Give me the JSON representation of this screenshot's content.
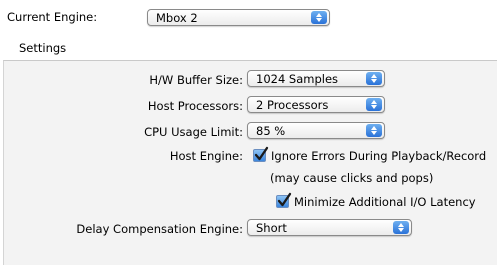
{
  "current_engine": {
    "label": "Current Engine:",
    "value": "Mbox 2"
  },
  "settings": {
    "group_title": "Settings",
    "hw_buffer": {
      "label": "H/W Buffer Size:",
      "value": "1024 Samples"
    },
    "host_processors": {
      "label": "Host Processors:",
      "value": "2 Processors"
    },
    "cpu_limit": {
      "label": "CPU Usage Limit:",
      "value": "85 %"
    },
    "host_engine": {
      "label": "Host Engine:",
      "ignore_errors": {
        "label": "Ignore Errors During Playback/Record",
        "checked": true
      },
      "note": "(may cause clicks and pops)",
      "minimize_latency": {
        "label": "Minimize Additional I/O Latency",
        "checked": true
      }
    },
    "delay_comp": {
      "label": "Delay Compensation Engine:",
      "value": "Short"
    }
  },
  "colors": {
    "accent": "#2a72d8",
    "check": "#3b86de",
    "panel": "#f3f3f3"
  }
}
